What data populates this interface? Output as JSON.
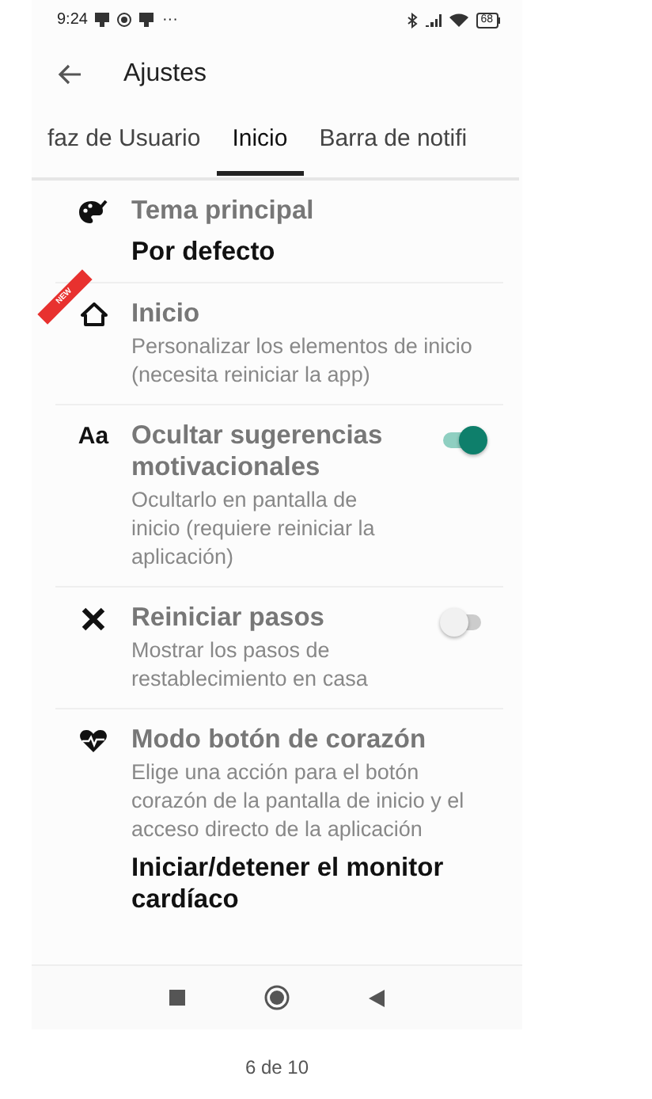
{
  "status_bar": {
    "time": "9:24",
    "more": "···",
    "battery": "68"
  },
  "app_bar": {
    "title": "Ajustes"
  },
  "tabs": [
    {
      "label": "faz de Usuario",
      "selected": false
    },
    {
      "label": "Inicio",
      "selected": true
    },
    {
      "label": "Barra de notifi",
      "selected": false
    }
  ],
  "settings": [
    {
      "kind": "value",
      "title": "Tema principal",
      "value": "Por defecto"
    },
    {
      "kind": "info",
      "title": "Inicio",
      "subtitle": "Personalizar los elementos de inicio (necesita reiniciar la app)",
      "badge": "NEW"
    },
    {
      "kind": "switch",
      "icon_text": "Aa",
      "title": "Ocultar sugerencias motivacionales",
      "subtitle": "Ocultarlo en pantalla de inicio (requiere reiniciar la aplicación)",
      "on": true
    },
    {
      "kind": "switch",
      "title": "Reiniciar pasos",
      "subtitle": "Mostrar los pasos de restablecimiento en casa",
      "on": false
    },
    {
      "kind": "value",
      "title": "Modo botón de corazón",
      "subtitle": "Elige una acción para el botón corazón de la pantalla de inicio y el acceso directo de la aplicación",
      "value": "Iniciar/detener el monitor cardíaco"
    }
  ],
  "pager": "6 de 10"
}
